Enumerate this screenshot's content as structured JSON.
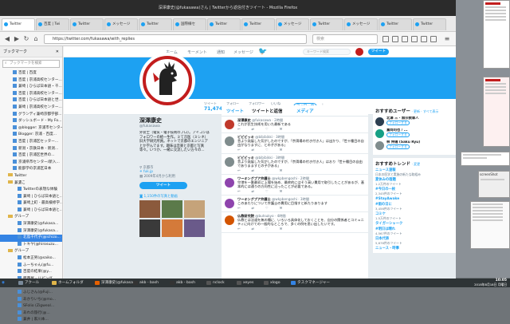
{
  "window": {
    "title": "深澤康史(@fukasawa)さん | Twitterから返信付きツイート - Mozilla Firefox"
  },
  "tabs": [
    {
      "label": "Twitter",
      "color": "#1da1f2"
    },
    {
      "label": "百度 | Twi",
      "color": "#1da1f2"
    },
    {
      "label": "Twitter",
      "color": "#1da1f2"
    },
    {
      "label": "メッセージ",
      "color": "#1da1f2"
    },
    {
      "label": "Twitter",
      "color": "#1da1f2"
    },
    {
      "label": "国際線セ",
      "color": "#1da1f2"
    },
    {
      "label": "Twitter",
      "color": "#1da1f2"
    },
    {
      "label": "Twitter",
      "color": "#1da1f2"
    },
    {
      "label": "メッセージ",
      "color": "#1da1f2"
    },
    {
      "label": "Twitter",
      "color": "#1da1f2"
    },
    {
      "label": "メッセージ",
      "color": "#1da1f2"
    },
    {
      "label": "Twitter",
      "color": "#1da1f2"
    },
    {
      "label": "Twitter",
      "color": "#1da1f2"
    }
  ],
  "nav": {
    "url": "https://twitter.com/fukasawa/with_replies",
    "search_placeholder": "検索"
  },
  "sidebar": {
    "title": "ブックマーク",
    "search_placeholder": "ブックマークを検索",
    "items": [
      {
        "label": "百度 | 百度",
        "type": "file"
      },
      {
        "label": "百度 | 京浦高校センター...",
        "type": "file"
      },
      {
        "label": "兼崎 | ひらば日本語・千...",
        "type": "file"
      },
      {
        "label": "百度 | 京浦高校センター...",
        "type": "file"
      },
      {
        "label": "百度 | ひらば日本語と世...",
        "type": "file"
      },
      {
        "label": "兼崎 | 京浦高校センター...",
        "type": "file"
      },
      {
        "label": "グランディ兼崎京都学部...",
        "type": "file"
      },
      {
        "label": "ダッシュボード - My Fo...",
        "type": "file"
      },
      {
        "label": "@blogger: 京浦市センター...",
        "type": "file"
      },
      {
        "label": "Blogger: 京浦 - 百度...",
        "type": "file"
      },
      {
        "label": "百度 | 京浦区セッター...",
        "type": "file"
      },
      {
        "label": "新潟・京鉄日本 - 新潟...",
        "type": "file"
      },
      {
        "label": "百度 | 京浦区世界の...",
        "type": "file"
      },
      {
        "label": "京浦県市センター/新入...",
        "type": "file"
      },
      {
        "label": "能部学の京浦区日本",
        "type": "file"
      },
      {
        "label": "Twitter",
        "type": "folder"
      },
      {
        "label": "兼濃こ",
        "type": "folder"
      },
      {
        "label": "Twitterの表現な体験",
        "type": "file"
      },
      {
        "label": "兼崎 | ひらば日本語と...",
        "type": "file"
      },
      {
        "label": "兼崎上町 - 最高検修学...",
        "type": "file"
      },
      {
        "label": "兼崎 | ひらば日本語と...",
        "type": "file"
      },
      {
        "label": "グループ",
        "type": "folder"
      },
      {
        "label": "深澤康史(@fukasa...",
        "type": "file"
      },
      {
        "label": "深澤康史(@fukasa...",
        "type": "file"
      },
      {
        "label": "北島千代子(@ichizo...",
        "type": "file",
        "selected": true
      },
      {
        "label": "トキヤ(@hirosuzu...",
        "type": "file"
      },
      {
        "label": "グループ",
        "type": "folder"
      },
      {
        "label": "松本正男(@saiko...",
        "type": "file"
      },
      {
        "label": "ふーちゃん(@fu...",
        "type": "file"
      },
      {
        "label": "百度の結果(@y...",
        "type": "file"
      },
      {
        "label": "面西屋 - リビング...",
        "type": "file"
      },
      {
        "label": "京浦工士センター...",
        "type": "file"
      },
      {
        "label": "ふじさん(@Fuji...",
        "type": "file"
      },
      {
        "label": "あかりいち(@mo...",
        "type": "file"
      },
      {
        "label": "SFolio (Zigweal...",
        "type": "file"
      },
      {
        "label": "あれの旅行(@...",
        "type": "file"
      },
      {
        "label": "兼井 | 家川本...",
        "type": "file"
      }
    ]
  },
  "twitter_nav": {
    "home": "ホーム",
    "moments": "モーメント",
    "notifications": "通知",
    "messages": "メッセージ",
    "search_placeholder": "キーワード検索",
    "tweet_button": "ツイート"
  },
  "profile": {
    "name": "深澤康史",
    "handle": "@fukasawa",
    "bio": "外装士（電気・電子技術のプロ）。アイコンはフォロワーの絵一生作。ミて京医（ミシネ）旧大学研究所員。ネットで京都のエンジニアとか学んでます。趣味は音楽と京都と写真等々。いつか、一緒に交流したい方々の…",
    "location": "京都市",
    "website": "fuk.jp",
    "joined": "2009年4月から利用",
    "tweet_button": "ツイート",
    "media_label": "1,150件の写真と動画",
    "stats": [
      {
        "label": "ツイート",
        "value": "71,474"
      },
      {
        "label": "フォロー",
        "value": "453"
      },
      {
        "label": "フォロワー",
        "value": "6,558"
      },
      {
        "label": "いいね",
        "value": "23,740"
      }
    ],
    "follow_button": "フォロー中",
    "accent_color": "#1da1f2"
  },
  "feed": {
    "tabs": [
      "ツイート",
      "ツイートと返信",
      "メディア"
    ],
    "tweets": [
      {
        "name": "深澤康史",
        "handle": "@fukasawa · 2時間",
        "text": "これが民生技術を用いた最新である",
        "color": "#c0392b"
      },
      {
        "name": "ビビビッキ",
        "handle": "@bibibikki · 3時間",
        "text": "昔より発展した気がしたのですが、「京滑場の付き付き人」は出かり、「世十種目の自由がなりますに、との子がある」",
        "color": "#7f8c8d"
      },
      {
        "name": "ビビビッキ",
        "handle": "@bibibikki · 3時間",
        "text": "昔より発展した気がしたのですが、「京滑場の付き付き人」はおり「世十種目の自由でありまますとの子がある」",
        "color": "#7f8c8d"
      },
      {
        "name": "ワーキングプア弁護士",
        "handle": "@wkpbengoshi · 2時間",
        "text": "空港を一番最初に上場を始め、最終的にはそう高い費用で取引したことがあるが、基本的には通りの方向性に沿ったことが必要である。",
        "color": "#8e44ad"
      },
      {
        "name": "ワーキングプア弁護士",
        "handle": "@wkpbengoshi · 3時間",
        "text": "このあたりについて弁護士の費用に目指すと新たりあります",
        "color": "#8e44ad"
      },
      {
        "name": "仏教研究院",
        "handle": "@butsukyo · 4時間",
        "text": "仏教とは法道を無の種に、いろいろ具体化しておくことを、自分の関係者とコミュニティに向けての一般的なところで、多くの例を思い出したいです。",
        "color": "#d35400"
      }
    ]
  },
  "who_to_follow": {
    "title": "おすすめユーザー",
    "links": "· 更新 · すべて表示",
    "follow_label": "フォローする",
    "users": [
      {
        "name": "北澤 三 · 無宗教軍人",
        "handle": "@kitazawa",
        "color": "#2c3e50"
      },
      {
        "name": "富岡司也 / ...",
        "handle": "@tomioka",
        "color": "#16a085"
      },
      {
        "name": "林 伸陽 (Saku Ryu)",
        "handle": "@hayashi",
        "color": "#7f8c8d"
      }
    ]
  },
  "trends": {
    "title": "おすすめトレンド",
    "links": "· 変更",
    "items": [
      {
        "tag": "ニュース速報",
        "count": "日本の医学と実施の新たな取組み"
      },
      {
        "tag": "夏休みの宿題",
        "count": "1.2万件のツイート"
      },
      {
        "tag": "#今日の一枚",
        "count": "2,345件のツイート"
      },
      {
        "tag": "#StayAwake",
        "count": ""
      },
      {
        "tag": "#雨の日に",
        "count": "3,456件のツイート"
      },
      {
        "tag": "コミケ",
        "count": "1.5万件のツイート"
      },
      {
        "tag": "タイガーシャーク",
        "count": ""
      },
      {
        "tag": "#明日は晴れ",
        "count": "4,567件のツイート"
      },
      {
        "tag": "日本代表",
        "count": "5,678件のツイート"
      },
      {
        "tag": "ニュース・時事",
        "count": ""
      }
    ]
  },
  "taskbar": {
    "items": [
      {
        "label": "アクール",
        "color": "#7a8a9a"
      },
      {
        "label": "ホームフォルダ",
        "color": "#e0b54a"
      },
      {
        "label": "深澤康史(@fukasa...",
        "color": "#e66000"
      },
      {
        "label": "akb - bash",
        "color": "#333"
      },
      {
        "label": "akb - bash",
        "color": "#333"
      },
      {
        "label": "nclock",
        "color": "#555"
      },
      {
        "label": "xeyes",
        "color": "#555"
      },
      {
        "label": "xlogo",
        "color": "#555"
      },
      {
        "label": "タスクマネージャー",
        "color": "#3584e4"
      }
    ],
    "time": "10:05",
    "date": "2018年8月18日 月曜日"
  },
  "desktop": {
    "window_label": "screenShot"
  }
}
